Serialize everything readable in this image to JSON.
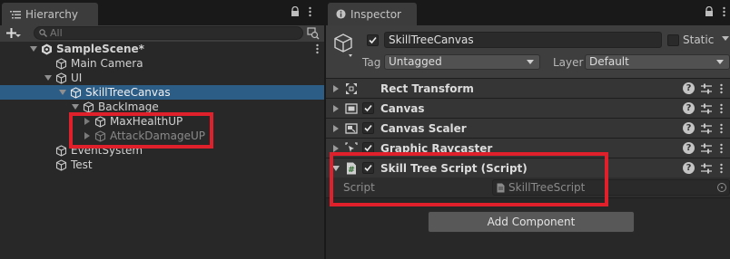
{
  "colors": {
    "selection": "#2c5d87",
    "highlight": "#e0202a",
    "panel_bg": "#282828",
    "header_bg": "#3e3e3e"
  },
  "hierarchy": {
    "tab_label": "Hierarchy",
    "search_placeholder": "All",
    "add_icon": "plus-icon",
    "items": [
      {
        "label": "SampleScene*",
        "icon": "unity-scene-icon"
      },
      {
        "label": "Main Camera",
        "icon": "gameobject-cube-icon"
      },
      {
        "label": "UI",
        "icon": "gameobject-cube-icon"
      },
      {
        "label": "SkillTreeCanvas",
        "icon": "gameobject-cube-icon",
        "selected": true
      },
      {
        "label": "BackImage",
        "icon": "gameobject-cube-icon"
      },
      {
        "label": "MaxHealthUP",
        "icon": "gameobject-cube-icon"
      },
      {
        "label": "AttackDamageUP",
        "icon": "gameobject-cube-icon",
        "inactive": true
      },
      {
        "label": "EventSystem",
        "icon": "gameobject-cube-icon"
      },
      {
        "label": "Test",
        "icon": "gameobject-cube-icon"
      }
    ]
  },
  "inspector": {
    "tab_label": "Inspector",
    "gameobject": {
      "name": "SkillTreeCanvas",
      "active": true,
      "static_label": "Static",
      "static": false,
      "tag_label": "Tag",
      "tag_value": "Untagged",
      "layer_label": "Layer",
      "layer_value": "Default"
    },
    "components": [
      {
        "title": "Rect Transform",
        "icon": "rect-transform-icon",
        "has_checkbox": false,
        "expanded": false
      },
      {
        "title": "Canvas",
        "icon": "canvas-icon",
        "has_checkbox": true,
        "expanded": false
      },
      {
        "title": "Canvas Scaler",
        "icon": "canvas-scaler-icon",
        "has_checkbox": true,
        "expanded": false
      },
      {
        "title": "Graphic Raycaster",
        "icon": "graphic-raycaster-icon",
        "has_checkbox": true,
        "expanded": false
      },
      {
        "title": "Skill Tree Script (Script)",
        "icon": "csharp-script-icon",
        "has_checkbox": true,
        "expanded": true
      }
    ],
    "script_property": {
      "label": "Script",
      "value": "SkillTreeScript"
    },
    "add_component_label": "Add Component"
  }
}
